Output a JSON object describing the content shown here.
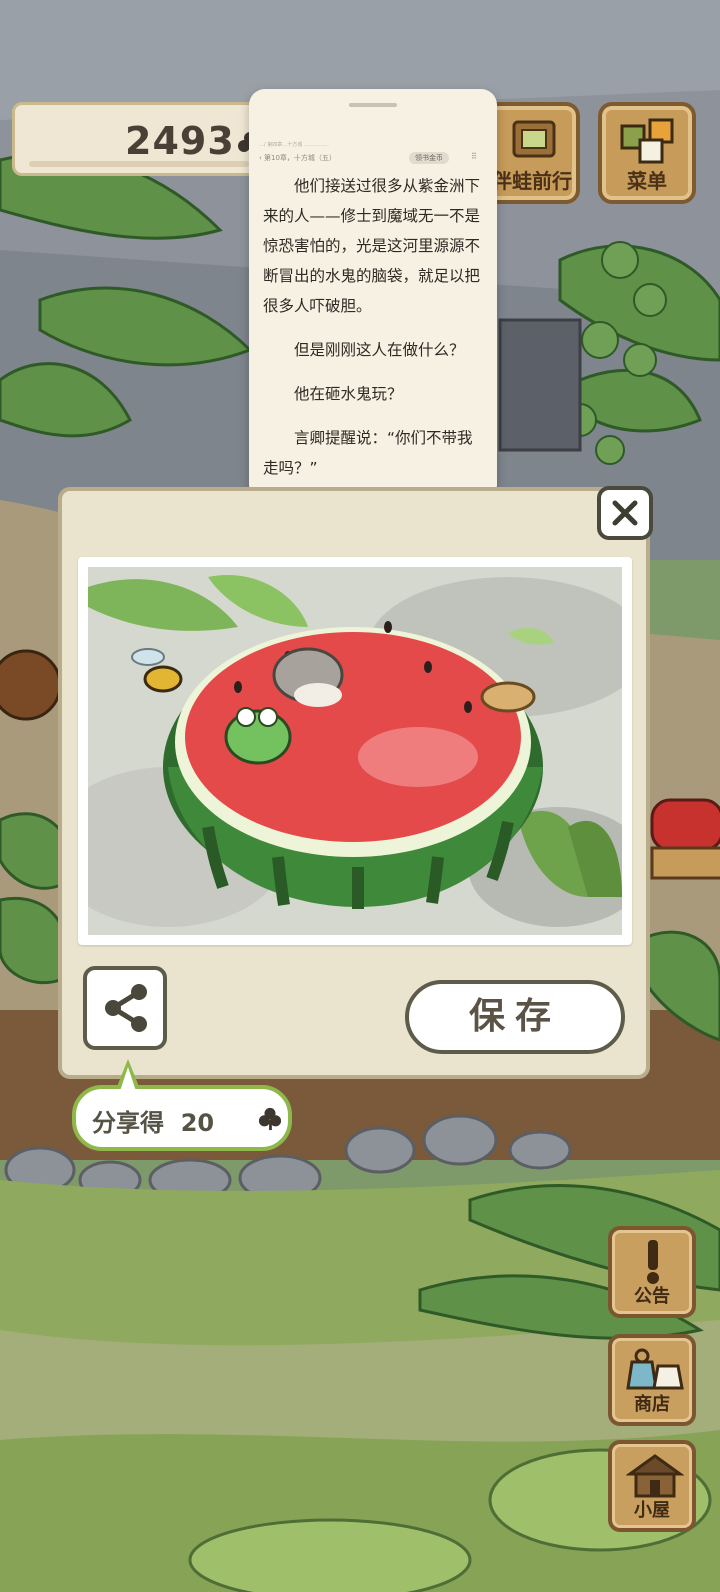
{
  "hud": {
    "clover_count": "2493",
    "buttons": [
      {
        "label": "伴蛙前行",
        "icon": "album-icon"
      },
      {
        "label": "菜单",
        "icon": "menu-cards-icon"
      }
    ]
  },
  "reader": {
    "breadcrumb": "…/ 第四章…十方城 ……………",
    "chapter": "‹ 第10章，十方城（五）",
    "coin_chip": "领书金币",
    "more": "⠿",
    "paragraphs": [
      "他们接送过很多从紫金洲下来的人——修士到魔域无一不是惊恐害怕的，光是这河里源源不断冒出的水鬼的脑袋，就足以把很多人吓破胆。",
      "但是刚刚这人在做什么？",
      "他在砸水鬼玩？",
      "言卿提醒说：“你们不带我走吗？”"
    ]
  },
  "dialog": {
    "close_symbol": "✕",
    "save_label": "保存",
    "share_reward_label": "分享得",
    "share_reward_amount": "20"
  },
  "side_menu": [
    {
      "label": "公告",
      "icon": "notice-icon"
    },
    {
      "label": "商店",
      "icon": "shop-bag-icon"
    },
    {
      "label": "小屋",
      "icon": "house-icon"
    }
  ],
  "colors": {
    "dialog_bg": "#eae3cd",
    "wood": "#c99f60",
    "bubble_border": "#8fb84a"
  }
}
